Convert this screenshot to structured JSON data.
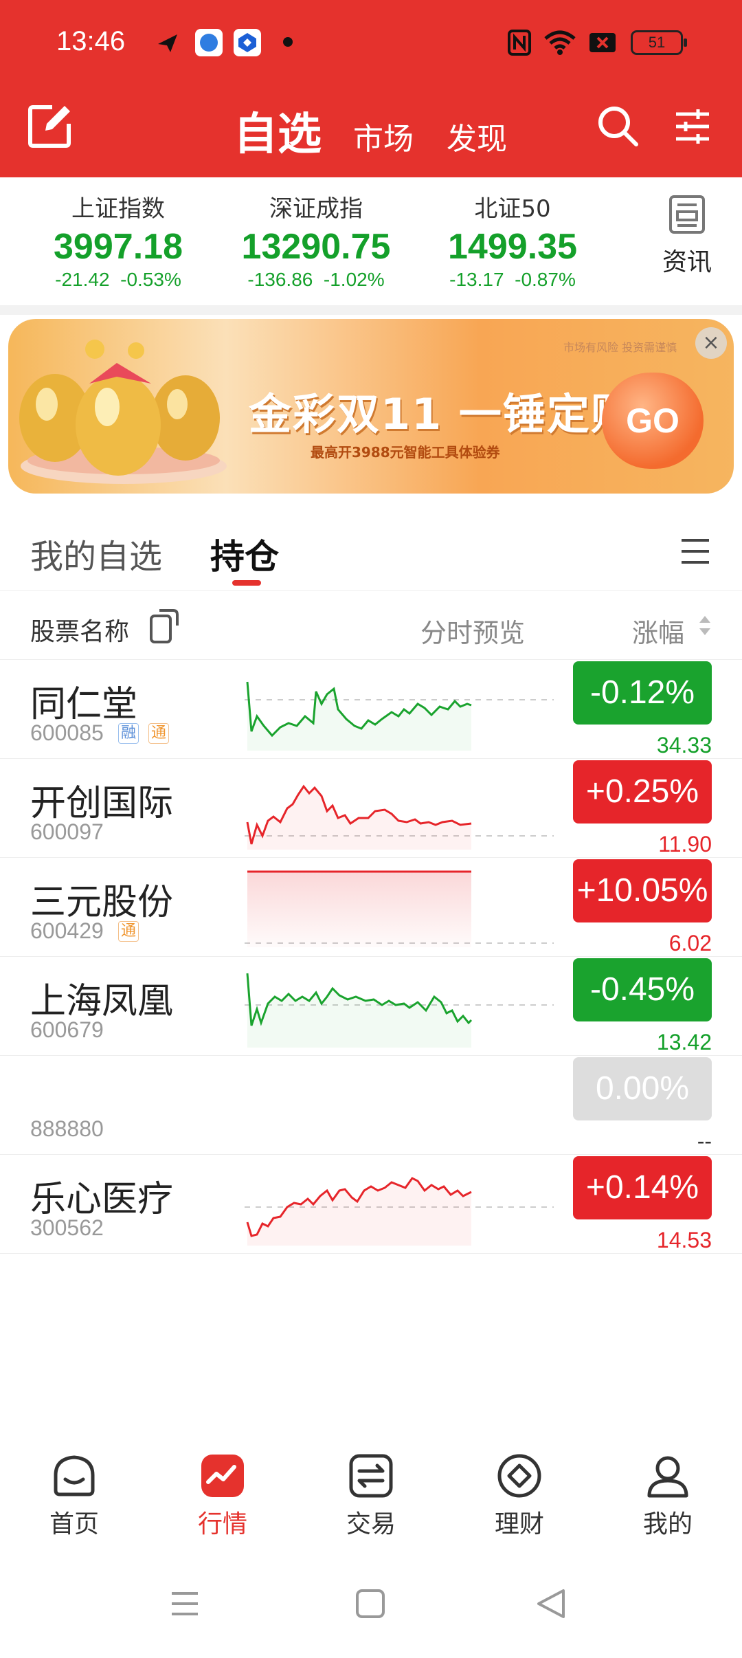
{
  "statusbar": {
    "time": "13:46",
    "battery": "51"
  },
  "header": {
    "tabs": [
      {
        "label": "自选",
        "active": true
      },
      {
        "label": "市场"
      },
      {
        "label": "发现"
      }
    ]
  },
  "indices": [
    {
      "name": "上证指数",
      "price": "3997.18",
      "change": "-21.42",
      "pct": "-0.53%"
    },
    {
      "name": "深证成指",
      "price": "13290.75",
      "change": "-136.86",
      "pct": "-1.02%"
    },
    {
      "name": "北证50",
      "price": "1499.35",
      "change": "-13.17",
      "pct": "-0.87%"
    }
  ],
  "news": {
    "label": "资讯"
  },
  "banner": {
    "title": "金彩双11 一锤定财",
    "subtitle": "最高开3988元智能工具体验券",
    "risk": "市场有风险 投资需谨慎",
    "go": "GO"
  },
  "subtabs": {
    "tab1": "我的自选",
    "tab2": "持仓"
  },
  "columns": {
    "name": "股票名称",
    "preview": "分时预览",
    "change": "涨幅"
  },
  "stocks": [
    {
      "name": "同仁堂",
      "code": "600085",
      "tags": [
        "融",
        "通"
      ],
      "pct": "-0.12%",
      "price": "34.33",
      "dir": "down"
    },
    {
      "name": "开创国际",
      "code": "600097",
      "tags": [],
      "pct": "+0.25%",
      "price": "11.90",
      "dir": "up"
    },
    {
      "name": "三元股份",
      "code": "600429",
      "tags": [
        "通"
      ],
      "pct": "+10.05%",
      "price": "6.02",
      "dir": "up"
    },
    {
      "name": "上海凤凰",
      "code": "600679",
      "tags": [],
      "pct": "-0.45%",
      "price": "13.42",
      "dir": "down"
    },
    {
      "name": "",
      "code": "888880",
      "tags": [],
      "pct": "0.00%",
      "price": "--",
      "dir": "flat"
    },
    {
      "name": "乐心医疗",
      "code": "300562",
      "tags": [],
      "pct": "+0.14%",
      "price": "14.53",
      "dir": "up"
    }
  ],
  "bottomnav": [
    {
      "label": "首页",
      "icon": "home-icon"
    },
    {
      "label": "行情",
      "icon": "market-chart-icon",
      "active": true
    },
    {
      "label": "交易",
      "icon": "trade-icon"
    },
    {
      "label": "理财",
      "icon": "finance-icon"
    },
    {
      "label": "我的",
      "icon": "profile-icon"
    }
  ],
  "colors": {
    "brand": "#e5322d",
    "up": "#e6252a",
    "down": "#1aa32e",
    "flat": "#dddddd"
  }
}
